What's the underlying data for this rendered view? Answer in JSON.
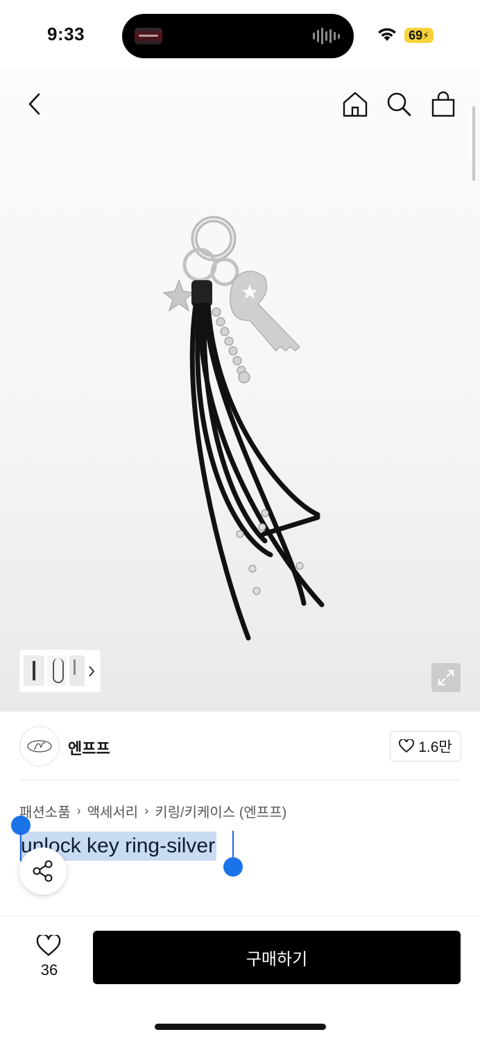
{
  "status_bar": {
    "time": "9:33",
    "battery": "69",
    "icons": [
      "wifi-icon",
      "battery-charging-icon"
    ]
  },
  "nav": {
    "icons": [
      "back-icon",
      "home-icon",
      "search-icon",
      "bag-icon"
    ]
  },
  "product_image": {
    "thumbnail_count": 3,
    "icons": [
      "chevron-right-icon",
      "expand-icon"
    ]
  },
  "seller": {
    "name": "엔프프",
    "favorites": "1.6만"
  },
  "breadcrumb": {
    "items": [
      "패션소품",
      "액세서리",
      "키링/키케이스 (엔프프)"
    ]
  },
  "product": {
    "title": "unlock key ring-silver"
  },
  "bottom_bar": {
    "like_count": "36",
    "buy_label": "구매하기"
  }
}
